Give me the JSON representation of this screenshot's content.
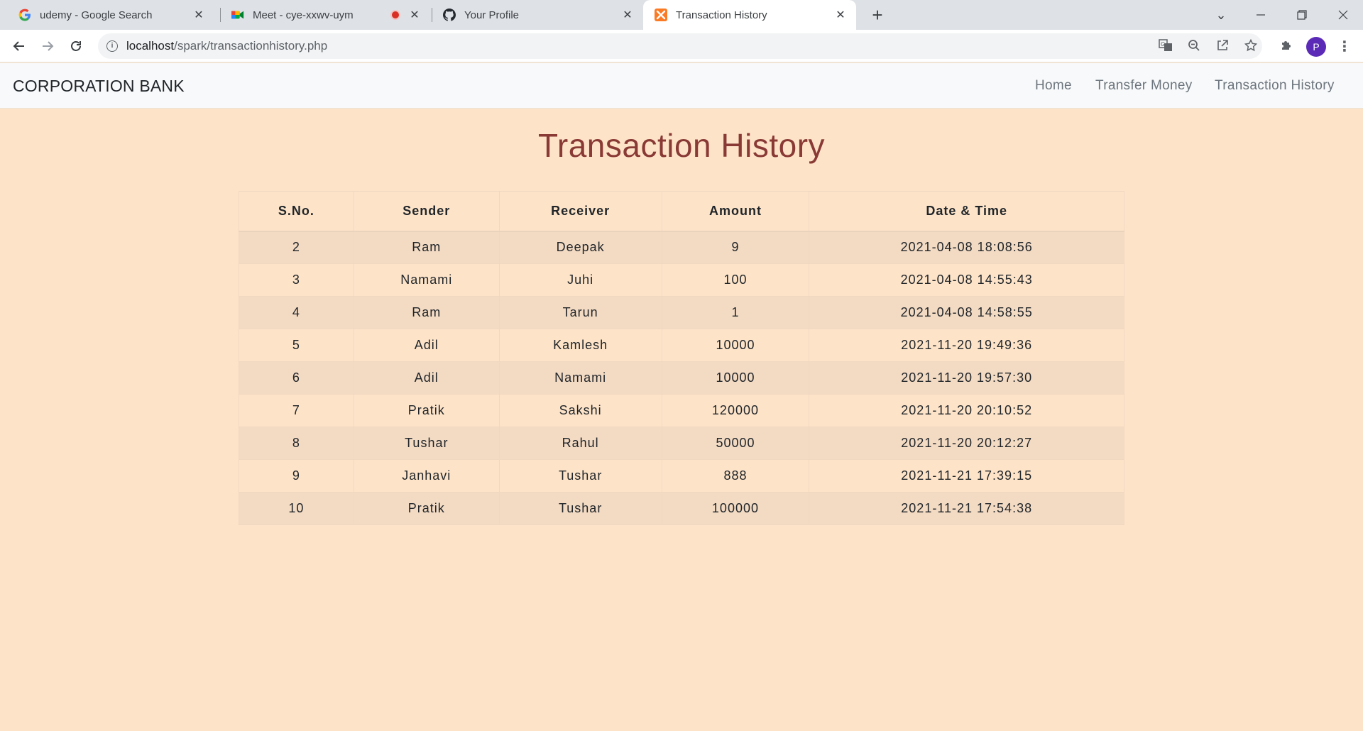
{
  "browser": {
    "tabs": [
      {
        "title": "udemy - Google Search",
        "icon": "google-icon"
      },
      {
        "title": "Meet - cye-xxwv-uym",
        "icon": "meet-icon"
      },
      {
        "title": "Your Profile",
        "icon": "github-icon"
      },
      {
        "title": "Transaction History",
        "icon": "xampp-icon"
      }
    ],
    "url_host": "localhost",
    "url_path": "/spark/transactionhistory.php",
    "profile_initial": "P",
    "colors": {
      "recording": "#d93025",
      "avatar": "#5b2bb8"
    }
  },
  "site": {
    "brand": "CORPORATION BANK",
    "nav": [
      "Home",
      "Transfer Money",
      "Transaction History"
    ]
  },
  "page": {
    "title": "Transaction History",
    "columns": [
      "S.No.",
      "Sender",
      "Receiver",
      "Amount",
      "Date & Time"
    ],
    "rows": [
      [
        "2",
        "Ram",
        "Deepak",
        "9",
        "2021-04-08 18:08:56"
      ],
      [
        "3",
        "Namami",
        "Juhi",
        "100",
        "2021-04-08 14:55:43"
      ],
      [
        "4",
        "Ram",
        "Tarun",
        "1",
        "2021-04-08 14:58:55"
      ],
      [
        "5",
        "Adil",
        "Kamlesh",
        "10000",
        "2021-11-20 19:49:36"
      ],
      [
        "6",
        "Adil",
        "Namami",
        "10000",
        "2021-11-20 19:57:30"
      ],
      [
        "7",
        "Pratik",
        "Sakshi",
        "120000",
        "2021-11-20 20:10:52"
      ],
      [
        "8",
        "Tushar",
        "Rahul",
        "50000",
        "2021-11-20 20:12:27"
      ],
      [
        "9",
        "Janhavi",
        "Tushar",
        "888",
        "2021-11-21 17:39:15"
      ],
      [
        "10",
        "Pratik",
        "Tushar",
        "100000",
        "2021-11-21 17:54:38"
      ]
    ],
    "colors": {
      "title": "#8a3a35",
      "background": "#fde4c9",
      "stripe": "#f2dac3"
    }
  }
}
